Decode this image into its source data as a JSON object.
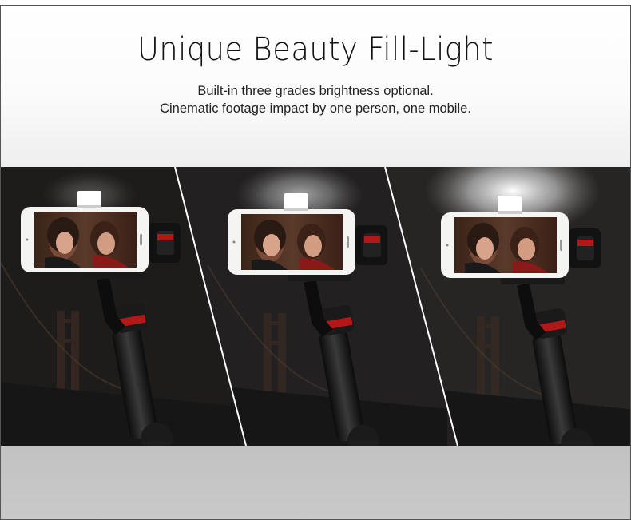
{
  "header": {
    "title": "Unique Beauty Fill-Light",
    "subtitle_line1": "Built-in three grades brightness optional.",
    "subtitle_line2": "Cinematic footage impact by one person, one mobile."
  },
  "panels": [
    {
      "name": "brightness-low",
      "glow": 0.25
    },
    {
      "name": "brightness-medium",
      "glow": 0.6
    },
    {
      "name": "brightness-high",
      "glow": 1.0
    }
  ],
  "colors": {
    "accent_red": "#b31818",
    "background_dark": "#1c1c1c",
    "footer_gray": "#c4c4c4"
  }
}
